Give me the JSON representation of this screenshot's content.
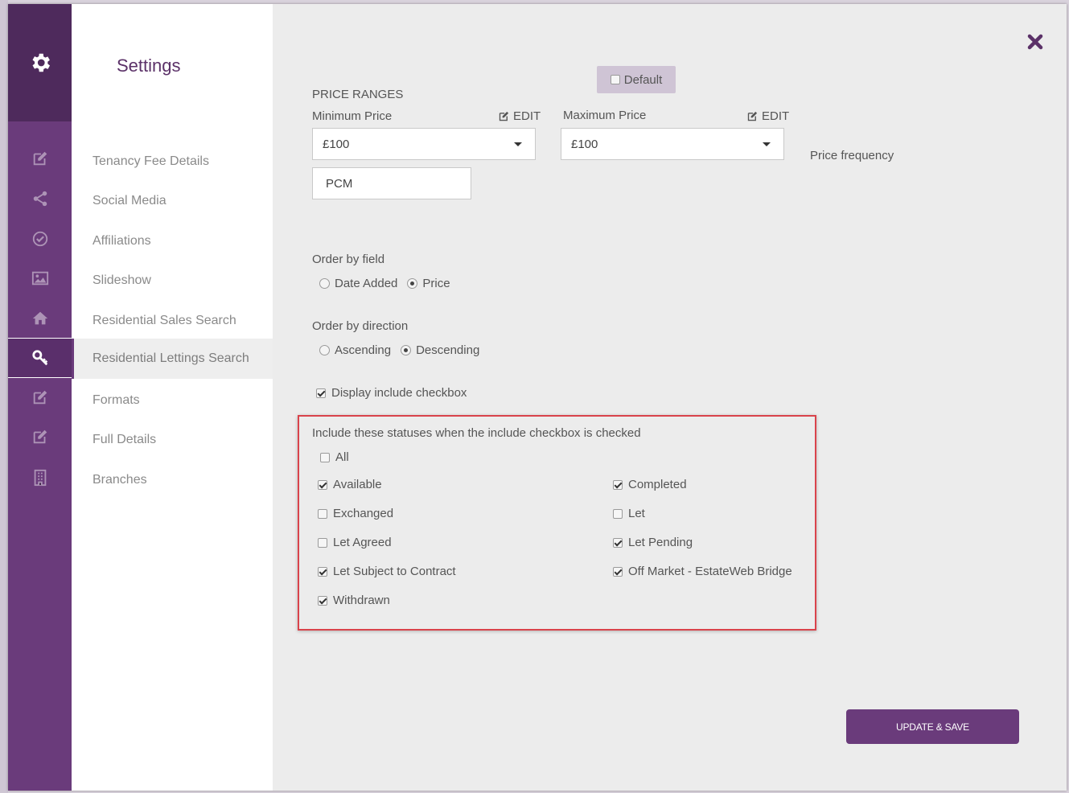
{
  "nav": {
    "title": "Settings",
    "items": [
      {
        "label": "Tenancy Fee Details"
      },
      {
        "label": "Social Media"
      },
      {
        "label": "Affiliations"
      },
      {
        "label": "Slideshow"
      },
      {
        "label": "Residential Sales Search"
      },
      {
        "label": "Residential Lettings Search"
      },
      {
        "label": "Formats"
      },
      {
        "label": "Full Details"
      },
      {
        "label": "Branches"
      }
    ],
    "active_item": "Residential Lettings Search"
  },
  "rail": {
    "icons": [
      "gear-icon",
      "edit-icon",
      "share-icon",
      "check-circle-icon",
      "image-icon",
      "home-icon",
      "key-icon",
      "edit-icon",
      "edit-icon",
      "building-icon"
    ],
    "active_icon": "key-icon"
  },
  "colors": {
    "brand_purple": "#6a3b7b",
    "brand_purple_dark": "#4e2a5c",
    "highlight_red": "#d9434b"
  },
  "form": {
    "default_label": "Default",
    "default_checked": false,
    "price_ranges_heading": "PRICE RANGES",
    "min_price_label": "Minimum Price",
    "min_price_edit": "EDIT",
    "min_price_value": "£100",
    "max_price_label": "Maximum Price",
    "max_price_edit": "EDIT",
    "max_price_value": "£100",
    "price_frequency_label": "Price frequency",
    "price_frequency_value": "PCM",
    "order_field_label": "Order by field",
    "order_field_options": [
      {
        "label": "Date Added",
        "selected": false
      },
      {
        "label": "Price",
        "selected": true
      }
    ],
    "order_direction_label": "Order by direction",
    "order_direction_options": [
      {
        "label": "Ascending",
        "selected": false
      },
      {
        "label": "Descending",
        "selected": true
      }
    ],
    "display_include_label": "Display include checkbox",
    "display_include_checked": true,
    "statuses_heading": "Include these statuses when the include checkbox is checked",
    "all_label": "All",
    "all_checked": false,
    "statuses": [
      {
        "label": "Available",
        "checked": true
      },
      {
        "label": "Completed",
        "checked": true
      },
      {
        "label": "Exchanged",
        "checked": false
      },
      {
        "label": "Let",
        "checked": false
      },
      {
        "label": "Let Agreed",
        "checked": false
      },
      {
        "label": "Let Pending",
        "checked": true
      },
      {
        "label": "Let Subject to Contract",
        "checked": true
      },
      {
        "label": "Off Market - EstateWeb Bridge",
        "checked": true
      },
      {
        "label": "Withdrawn",
        "checked": true
      }
    ],
    "update_button": "UPDATE & SAVE"
  }
}
